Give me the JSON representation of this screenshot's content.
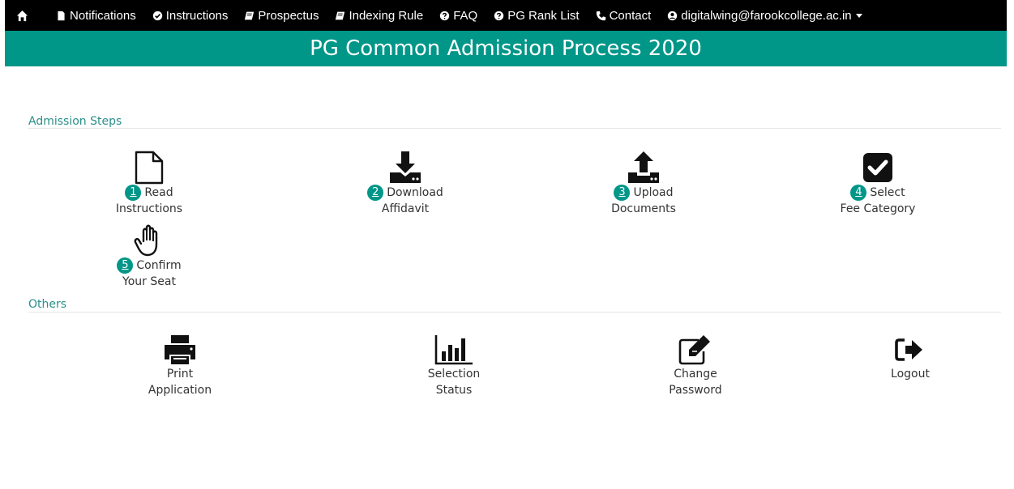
{
  "nav": {
    "items": [
      {
        "label": "Notifications",
        "icon": "file-icon"
      },
      {
        "label": "Instructions",
        "icon": "check-circle-icon"
      },
      {
        "label": "Prospectus",
        "icon": "book-icon"
      },
      {
        "label": "Indexing Rule",
        "icon": "book-icon"
      },
      {
        "label": "FAQ",
        "icon": "question-circle-icon"
      },
      {
        "label": "PG Rank List",
        "icon": "question-circle-icon"
      },
      {
        "label": "Contact",
        "icon": "phone-icon"
      }
    ],
    "user_email": "digitalwing@farookcollege.ac.in"
  },
  "banner": {
    "title": "PG Common Admission Process 2020"
  },
  "admission_steps": {
    "title": "Admission Steps",
    "steps": [
      {
        "num": "1",
        "line1": "Read",
        "line2": "Instructions",
        "icon": "file-outline-icon"
      },
      {
        "num": "2",
        "line1": "Download",
        "line2": "Affidavit",
        "icon": "download-icon"
      },
      {
        "num": "3",
        "line1": "Upload",
        "line2": "Documents",
        "icon": "upload-icon"
      },
      {
        "num": "4",
        "line1": "Select",
        "line2": "Fee Category",
        "icon": "check-square-icon"
      },
      {
        "num": "5",
        "line1": "Confirm",
        "line2": "Your Seat",
        "icon": "hand-stop-icon"
      }
    ]
  },
  "others": {
    "title": "Others",
    "items": [
      {
        "line1": "Print",
        "line2": "Application",
        "icon": "print-icon"
      },
      {
        "line1": "Selection",
        "line2": "Status",
        "icon": "bar-chart-icon"
      },
      {
        "line1": "Change",
        "line2": "Password",
        "icon": "edit-icon"
      },
      {
        "line1": "Logout",
        "line2": "",
        "icon": "sign-out-icon"
      }
    ]
  },
  "colors": {
    "accent": "#009688",
    "nav_bg": "#000000",
    "section_text": "#2a8f8a"
  }
}
